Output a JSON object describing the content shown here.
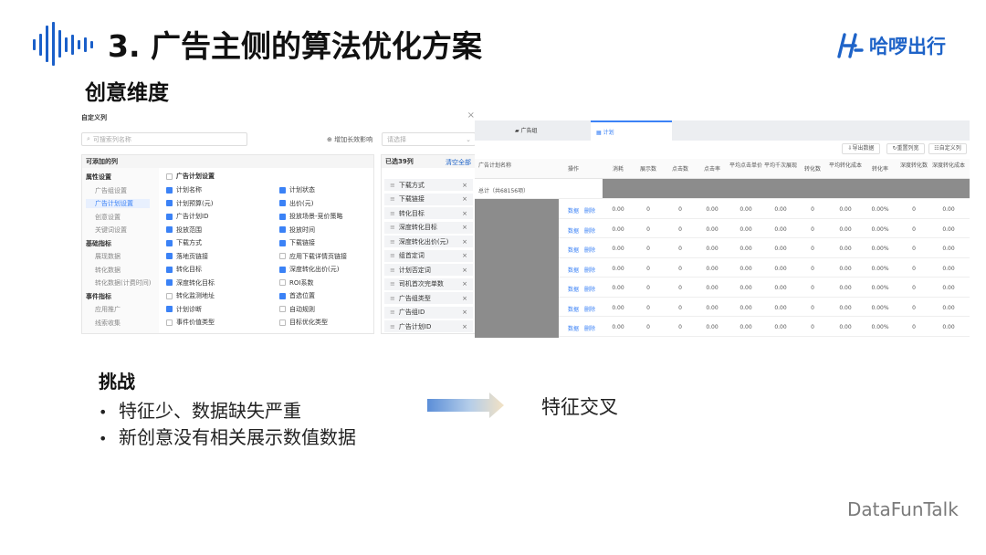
{
  "title": "3. 广告主侧的算法优化方案",
  "logo_text": "哈啰出行",
  "subtitle": "创意维度",
  "shot1": {
    "dialog_title": "自定义列",
    "search_placeholder": "可搜索列名称",
    "add_dimension": "增加长效影响",
    "select_placeholder": "请选择",
    "available_header": "可添加的列",
    "selected_header": "已选39列",
    "clear_all": "清空全部",
    "nav": [
      {
        "label": "属性设置",
        "type": "group"
      },
      {
        "label": "广告组设置",
        "type": "sub"
      },
      {
        "label": "广告计划设置",
        "type": "sub-active"
      },
      {
        "label": "创意设置",
        "type": "sub"
      },
      {
        "label": "关键词设置",
        "type": "sub"
      },
      {
        "label": "基础指标",
        "type": "group"
      },
      {
        "label": "展现数据",
        "type": "sub"
      },
      {
        "label": "转化数据",
        "type": "sub"
      },
      {
        "label": "转化数据(计费时间)",
        "type": "sub"
      },
      {
        "label": "事件指标",
        "type": "group"
      },
      {
        "label": "应用推广",
        "type": "sub"
      },
      {
        "label": "线索收集",
        "type": "sub"
      }
    ],
    "section_label": "广告计划设置",
    "left_options": [
      {
        "label": "计划名称",
        "checked": true
      },
      {
        "label": "计划预算(元)",
        "checked": true
      },
      {
        "label": "广告计划ID",
        "checked": true
      },
      {
        "label": "投放范围",
        "checked": true
      },
      {
        "label": "下载方式",
        "checked": true
      },
      {
        "label": "落地页链接",
        "checked": true
      },
      {
        "label": "转化目标",
        "checked": true
      },
      {
        "label": "深度转化目标",
        "checked": true
      },
      {
        "label": "转化监测地址",
        "checked": false
      },
      {
        "label": "计划诊断",
        "checked": true
      },
      {
        "label": "事件价值类型",
        "checked": false
      }
    ],
    "right_options": [
      {
        "label": "计划状态",
        "checked": true
      },
      {
        "label": "出价(元)",
        "checked": true
      },
      {
        "label": "投放场景-竞价策略",
        "checked": true
      },
      {
        "label": "投放时间",
        "checked": true
      },
      {
        "label": "下载链接",
        "checked": true
      },
      {
        "label": "应用下载详情页链接",
        "checked": false
      },
      {
        "label": "深度转化出价(元)",
        "checked": true
      },
      {
        "label": "ROI系数",
        "checked": false
      },
      {
        "label": "首选位置",
        "checked": true
      },
      {
        "label": "自动规则",
        "checked": false
      },
      {
        "label": "目标优化类型",
        "checked": false
      }
    ],
    "selected_items": [
      "下载方式",
      "下载链接",
      "转化目标",
      "深度转化目标",
      "深度转化出价(元)",
      "组首定词",
      "计划否定词",
      "司机首次完单数",
      "广告组类型",
      "广告组ID",
      "广告计划ID"
    ]
  },
  "shot2": {
    "tabs": [
      "广告组",
      "计划"
    ],
    "toolbar": [
      "导出数据",
      "重置列宽",
      "自定义列"
    ],
    "headers": [
      "广告计划名称",
      "操作",
      "消耗",
      "展示数",
      "点击数",
      "点击率",
      "平均点击单价",
      "平均千次展现",
      "转化数",
      "平均转化成本",
      "转化率",
      "深度转化数",
      "深度转化成本"
    ],
    "total_label": "总计（共68156项）",
    "actions": [
      "数据",
      "删除"
    ],
    "rows": [
      [
        "0.00",
        "0",
        "0",
        "0.00",
        "0.00",
        "0.00",
        "0",
        "0.00",
        "0.00%",
        "0",
        "0.00"
      ],
      [
        "0.00",
        "0",
        "0",
        "0.00",
        "0.00",
        "0.00",
        "0",
        "0.00",
        "0.00%",
        "0",
        "0.00"
      ],
      [
        "0.00",
        "0",
        "0",
        "0.00",
        "0.00",
        "0.00",
        "0",
        "0.00",
        "0.00%",
        "0",
        "0.00"
      ],
      [
        "0.00",
        "0",
        "0",
        "0.00",
        "0.00",
        "0.00",
        "0",
        "0.00",
        "0.00%",
        "0",
        "0.00"
      ],
      [
        "0.00",
        "0",
        "0",
        "0.00",
        "0.00",
        "0.00",
        "0",
        "0.00",
        "0.00%",
        "0",
        "0.00"
      ],
      [
        "0.00",
        "0",
        "0",
        "0.00",
        "0.00",
        "0.00",
        "0",
        "0.00",
        "0.00%",
        "0",
        "0.00"
      ],
      [
        "0.00",
        "0",
        "0",
        "0.00",
        "0.00",
        "0.00",
        "0",
        "0.00",
        "0.00%",
        "0",
        "0.00"
      ]
    ]
  },
  "challenge": {
    "heading": "挑战",
    "bullets": [
      "特征少、数据缺失严重",
      "新创意没有相关展示数值数据"
    ]
  },
  "solution": "特征交叉",
  "footer": "DataFunTalk",
  "colors": {
    "brand": "#1e63c8",
    "checkbox": "#3b82f6",
    "mask": "#8c8c8c"
  }
}
